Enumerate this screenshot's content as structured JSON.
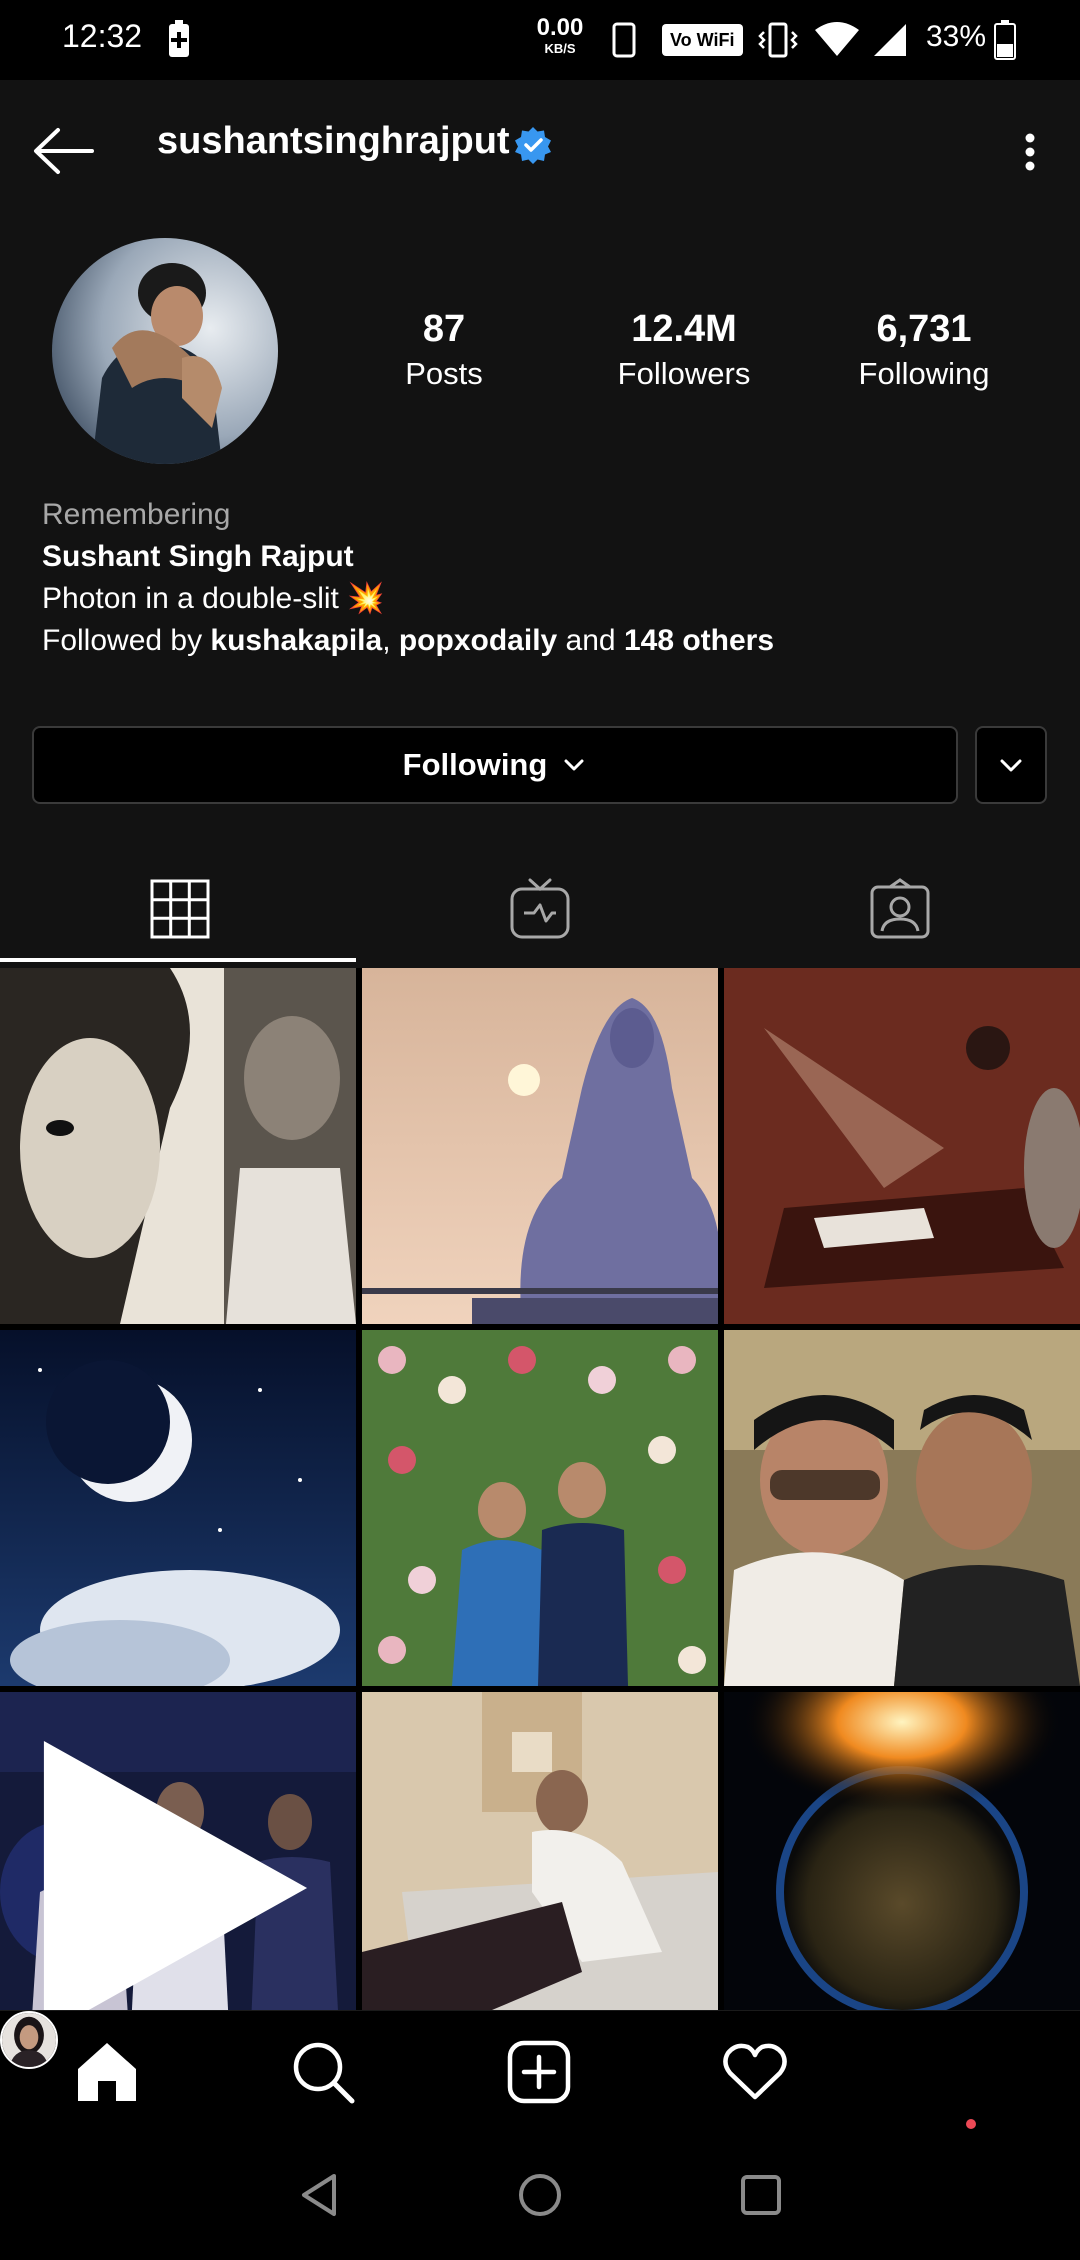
{
  "status_bar": {
    "time": "12:32",
    "net_speed_value": "0.00",
    "net_speed_unit": "KB/S",
    "volte_label": "Vo WiFi",
    "battery_percent": "33%"
  },
  "header": {
    "username": "sushantsinghrajput",
    "verified": true,
    "back_icon": "arrow-left-icon",
    "menu_icon": "more-vertical-icon"
  },
  "profile": {
    "stats": {
      "posts_value": "87",
      "posts_label": "Posts",
      "followers_value": "12.4M",
      "followers_label": "Followers",
      "following_value": "6,731",
      "following_label": "Following"
    },
    "bio": {
      "memorial_caption": "Remembering",
      "full_name": "Sushant Singh Rajput",
      "tagline": "Photon in a double-slit",
      "tagline_emoji": "💥",
      "followed_by_prefix": "Followed by ",
      "followed_by_user1": "kushakapila",
      "separator": ", ",
      "followed_by_user2": "popxodaily",
      "and_text": " and ",
      "others": "148 others"
    },
    "actions": {
      "following_button": "Following"
    }
  },
  "tabs": [
    {
      "icon": "grid-icon",
      "active": true
    },
    {
      "icon": "igtv-icon",
      "active": false
    },
    {
      "icon": "tagged-icon",
      "active": false
    }
  ],
  "posts_count_visible": 9,
  "bottom_nav": [
    {
      "icon": "home-icon",
      "active": true
    },
    {
      "icon": "search-icon"
    },
    {
      "icon": "add-post-icon"
    },
    {
      "icon": "heart-icon"
    },
    {
      "icon": "profile-avatar"
    }
  ],
  "colors": {
    "background": "#121212",
    "verified_blue": "#3897f0",
    "notification_red": "#ed4956"
  }
}
